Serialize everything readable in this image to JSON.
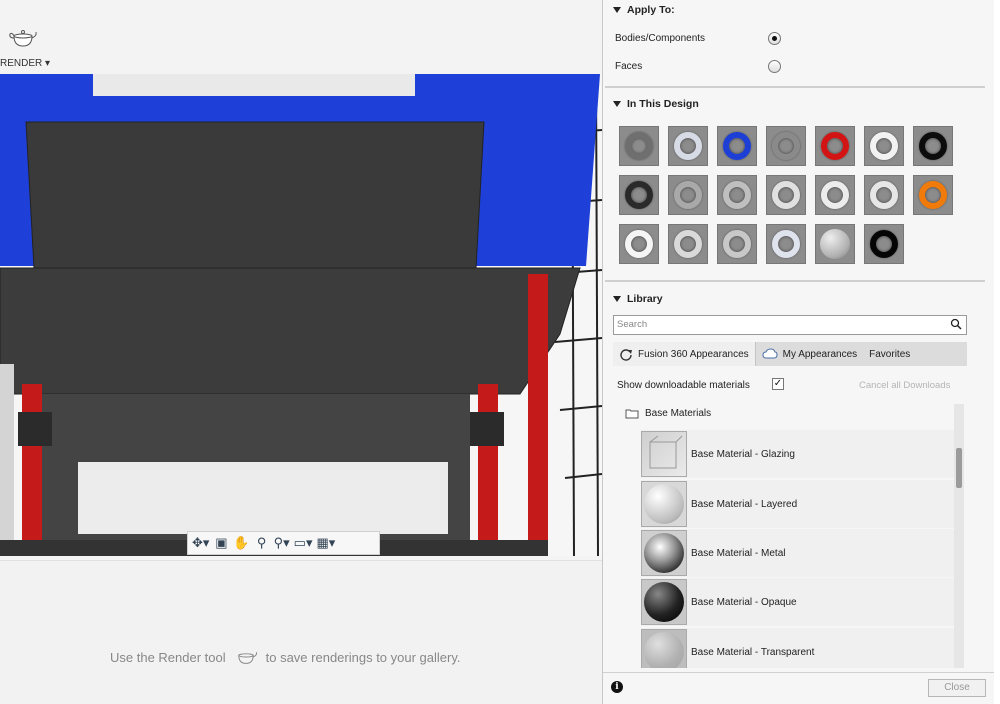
{
  "toolbar": {
    "render_menu_label": "RENDER ▾"
  },
  "gallery": {
    "message_before": "Use the Render tool",
    "message_after": "to save renderings to your gallery."
  },
  "panel": {
    "apply_to": {
      "title": "Apply To:",
      "options": [
        {
          "label": "Bodies/Components",
          "selected": true
        },
        {
          "label": "Faces",
          "selected": false
        }
      ]
    },
    "in_this_design": {
      "title": "In This Design",
      "swatches": [
        {
          "icon": "ring",
          "color": "#6f6f6f"
        },
        {
          "icon": "ring",
          "color": "#d7dbe6"
        },
        {
          "icon": "ring",
          "color": "#1d3fd6"
        },
        {
          "icon": "ring",
          "color": "#8a8a8a"
        },
        {
          "icon": "ring",
          "color": "#d21414"
        },
        {
          "icon": "ring",
          "color": "#f2f2f2"
        },
        {
          "icon": "ring",
          "color": "#0c0c0c"
        },
        {
          "icon": "ring",
          "color": "#2a2a2a"
        },
        {
          "icon": "ring",
          "color": "#a9a9a9"
        },
        {
          "icon": "ring",
          "color": "#bfbfbf"
        },
        {
          "icon": "ring",
          "color": "#e0e0e0"
        },
        {
          "icon": "ring",
          "color": "#ececec"
        },
        {
          "icon": "ring",
          "color": "#e6e6e6"
        },
        {
          "icon": "ring",
          "color": "#f07a0a"
        },
        {
          "icon": "ring",
          "color": "#f5f5f5"
        },
        {
          "icon": "ring",
          "color": "#d9d9d9"
        },
        {
          "icon": "ring",
          "color": "#c8c8c8"
        },
        {
          "icon": "ring",
          "color": "#dfe3ee"
        },
        {
          "icon": "ball",
          "color": "#b0b0b0"
        },
        {
          "icon": "ring",
          "color": "#050505"
        }
      ]
    },
    "library": {
      "title": "Library",
      "search_placeholder": "Search",
      "tabs": [
        "Fusion 360 Appearances",
        "My Appearances",
        "Favorites"
      ],
      "show_downloadable_label": "Show downloadable materials",
      "show_downloadable_checked": true,
      "cancel_downloads_label": "Cancel all Downloads",
      "folder": "Base Materials",
      "materials": [
        "Base Material - Glazing",
        "Base Material - Layered",
        "Base Material - Metal",
        "Base Material - Opaque",
        "Base Material - Transparent"
      ]
    },
    "close_label": "Close"
  },
  "colors": {
    "accent_blue": "#1e40d9",
    "red_post": "#c41a1a",
    "dark_body": "#3d3d3d"
  }
}
